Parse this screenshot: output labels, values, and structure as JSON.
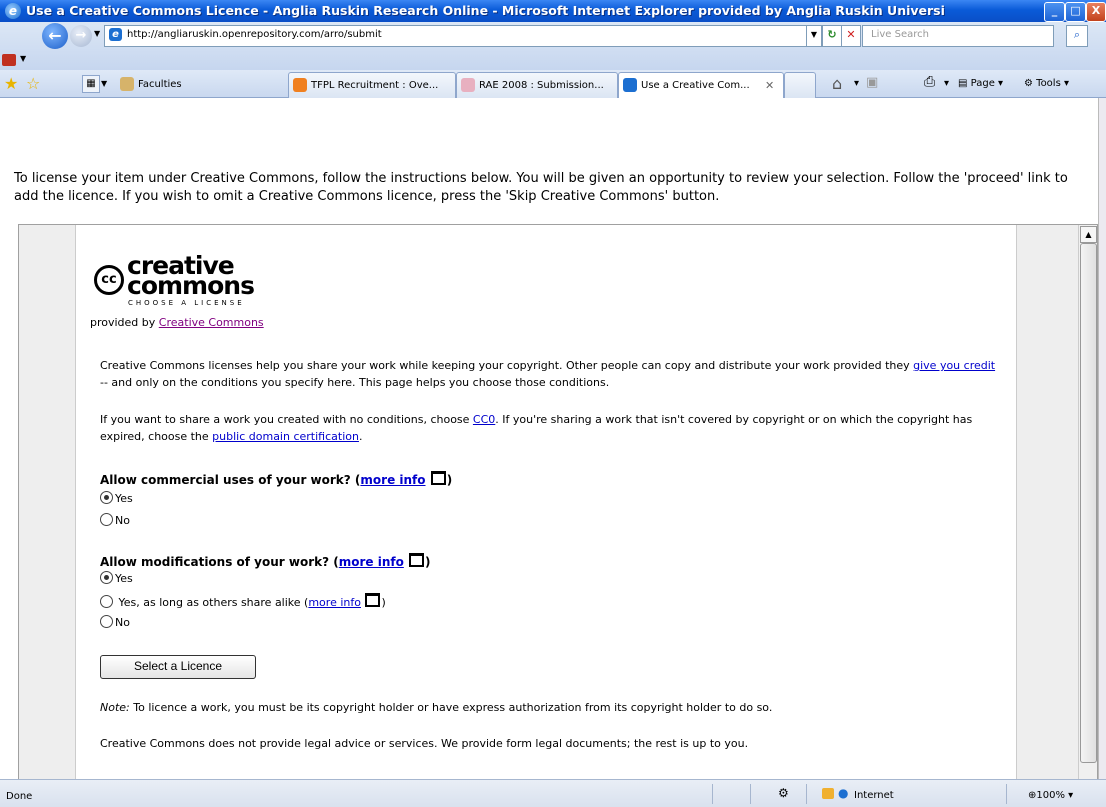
{
  "window": {
    "title": "Use a Creative Commons Licence - Anglia Ruskin Research Online - Microsoft Internet Explorer provided by Anglia Ruskin Universi",
    "minimize": "_",
    "restore": "□",
    "close": "X"
  },
  "address": {
    "url": "http://angliaruskin.openrepository.com/arro/submit",
    "search_placeholder": "Live Search"
  },
  "favorites": {
    "faculties_label": "Faculties"
  },
  "tabs": [
    {
      "label": "TFPL Recruitment : Ove..."
    },
    {
      "label": "RAE 2008 : Submission..."
    },
    {
      "label": "Use a Creative Com..."
    }
  ],
  "toolbar": {
    "page_label": "Page",
    "tools_label": "Tools"
  },
  "page": {
    "intro": "To license your item under Creative Commons, follow the instructions below. You will be given an opportunity to review your selection. Follow the 'proceed' link to add the licence. If you wish to omit a Creative Commons licence, press the 'Skip Creative Commons' button.",
    "logo_cc": "cc",
    "logo_line1": "creative",
    "logo_line2": "commons",
    "logo_tagline": "CHOOSE A LICENSE",
    "provided_by": "provided by ",
    "provided_by_link": "Creative Commons",
    "para1_a": "Creative Commons licenses help you share your work while keeping your copyright. Other people can copy and distribute your work provided they ",
    "para1_link": "give you credit",
    "para1_b": " -- and only on the conditions you specify here. This page helps you choose those conditions.",
    "para2_a": "If you want to share a work you created with no conditions, choose ",
    "para2_link1": "CC0",
    "para2_b": ". If you're sharing a work that isn't covered by copyright or on which the copyright has expired, choose the ",
    "para2_link2": "public domain certification",
    "para2_c": ".",
    "q1": "Allow commercial uses of your work? (",
    "q1_link": "more info",
    "q1_end": ")",
    "q1_yes": "Yes",
    "q1_no": "No",
    "q2": "Allow modifications of your work? (",
    "q2_link": "more info",
    "q2_end": ")",
    "q2_yes": "Yes",
    "q2_share": "Yes, as long as others share alike (",
    "q2_share_link": "more info",
    "q2_share_end": ")",
    "q2_no": "No",
    "select_button": "Select a Licence",
    "note_label": "Note:",
    "note_text": " To licence a work, you must be its copyright holder or have express authorization from its copyright holder to do so.",
    "disclaimer": "Creative Commons does not provide legal advice or services. We provide form legal documents; the rest is up to you."
  },
  "status": {
    "text": "Done",
    "zone": "Internet",
    "zoom": "100%"
  }
}
